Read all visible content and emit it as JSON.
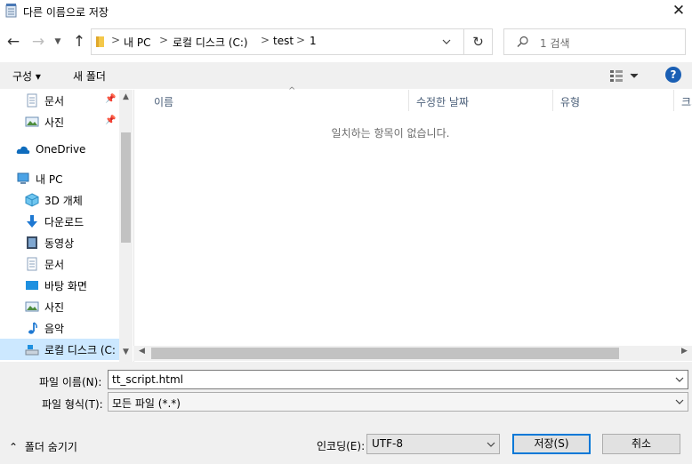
{
  "window": {
    "title": "다른 이름으로 저장",
    "close_icon": "close-icon"
  },
  "nav": {
    "back_icon": "arrow-left-icon",
    "forward_icon": "arrow-right-icon",
    "recent_icon": "chevron-down-icon",
    "up_icon": "arrow-up-icon"
  },
  "address": {
    "breadcrumbs": [
      "내 PC",
      "로컬 디스크 (C:)",
      "test",
      "1"
    ],
    "separator": ">",
    "refresh_icon": "refresh-icon"
  },
  "search": {
    "placeholder": "1 검색"
  },
  "toolbar": {
    "organize_label": "구성 ▾",
    "new_folder_label": "새 폴더",
    "help_label": "?"
  },
  "sidebar": {
    "items": [
      {
        "label": "문서",
        "icon": "document-icon",
        "pinned": true
      },
      {
        "label": "사진",
        "icon": "pictures-icon",
        "pinned": true
      },
      {
        "label": "OneDrive",
        "icon": "cloud-icon"
      },
      {
        "label": "내 PC",
        "icon": "computer-icon"
      },
      {
        "label": "3D 개체",
        "icon": "cube-icon"
      },
      {
        "label": "다운로드",
        "icon": "download-icon"
      },
      {
        "label": "동영상",
        "icon": "video-icon"
      },
      {
        "label": "문서",
        "icon": "document-icon"
      },
      {
        "label": "바탕 화면",
        "icon": "desktop-icon"
      },
      {
        "label": "사진",
        "icon": "pictures-icon"
      },
      {
        "label": "음악",
        "icon": "music-icon"
      },
      {
        "label": "로컬 디스크 (C:",
        "icon": "drive-icon",
        "selected": true
      }
    ]
  },
  "filelist": {
    "columns": [
      "이름",
      "수정한 날짜",
      "유형",
      "크기"
    ],
    "empty_message": "일치하는 항목이 없습니다."
  },
  "form": {
    "filename_label": "파일 이름(N):",
    "filename_value": "tt_script.html",
    "filetype_label": "파일 형식(T):",
    "filetype_value": "모든 파일 (*.*)",
    "hide_folders_label": "폴더 숨기기",
    "encoding_label": "인코딩(E):",
    "encoding_value": "UTF-8",
    "save_label": "저장(S)",
    "cancel_label": "취소"
  },
  "colors": {
    "accent": "#0078d7",
    "selection": "#cce8ff",
    "help": "#1a5fb4"
  }
}
